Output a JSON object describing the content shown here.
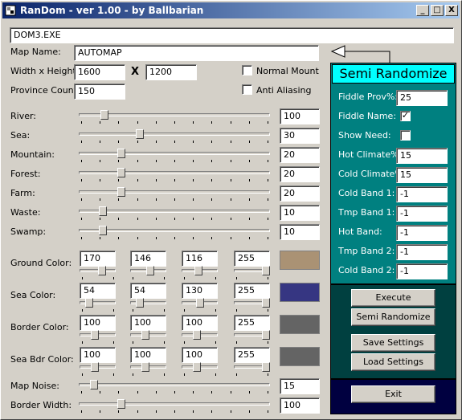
{
  "window": {
    "title": "RanDom - ver 1.00 - by Ballbarian",
    "minimize": "_",
    "maximize": "□",
    "close": "X"
  },
  "exe_field": {
    "value": "DOM3.EXE"
  },
  "map_name": {
    "label": "Map Name:",
    "value": "AUTOMAP"
  },
  "size": {
    "label": "Width x Height:",
    "width": "1600",
    "height": "1200",
    "separator": "X"
  },
  "province": {
    "label": "Province Count:",
    "value": "150"
  },
  "options": {
    "normal_mount": {
      "label": "Normal Mount",
      "checked": false
    },
    "anti_aliasing": {
      "label": "Anti Aliasing",
      "checked": false
    }
  },
  "terrain": [
    {
      "label": "River:",
      "value": "100",
      "level": 0.12
    },
    {
      "label": "Sea:",
      "value": "30",
      "level": 0.31
    },
    {
      "label": "Mountain:",
      "value": "20",
      "level": 0.21
    },
    {
      "label": "Forest:",
      "value": "20",
      "level": 0.21
    },
    {
      "label": "Farm:",
      "value": "20",
      "level": 0.21
    },
    {
      "label": "Waste:",
      "value": "10",
      "level": 0.11
    },
    {
      "label": "Swamp:",
      "value": "10",
      "level": 0.11
    }
  ],
  "colors": [
    {
      "label": "Ground Color:",
      "values": [
        "170",
        "146",
        "116",
        "255"
      ],
      "swatch": "#aa9274"
    },
    {
      "label": "Sea Color:",
      "values": [
        "54",
        "54",
        "130",
        "255"
      ],
      "swatch": "#363682"
    },
    {
      "label": "Border Color:",
      "values": [
        "100",
        "100",
        "100",
        "255"
      ],
      "swatch": "#646464"
    },
    {
      "label": "Sea Bdr Color:",
      "values": [
        "100",
        "100",
        "100",
        "255"
      ],
      "swatch": "#646464"
    }
  ],
  "map_noise": {
    "label": "Map Noise:",
    "value": "15",
    "level": 0.06
  },
  "border_width": {
    "label": "Border Width:",
    "value": "100",
    "level": 0.21
  },
  "semi": {
    "header": "Semi Randomize",
    "fields": [
      {
        "label": "Fiddle Prov%:",
        "value": "25"
      },
      {
        "label": "Fiddle Name:",
        "checkbox": true,
        "checked": true
      },
      {
        "label": "Show Need:",
        "checkbox": true,
        "checked": false
      },
      {
        "label": "Hot Climate%:",
        "value": "15"
      },
      {
        "label": "Cold Climate%:",
        "value": "15"
      },
      {
        "label": "Cold Band 1:",
        "value": "-1"
      },
      {
        "label": "Tmp Band 1:",
        "value": "-1"
      },
      {
        "label": "Hot Band:",
        "value": "-1"
      },
      {
        "label": "Tmp Band 2:",
        "value": "-1"
      },
      {
        "label": "Cold Band 2:",
        "value": "-1"
      }
    ]
  },
  "buttons": {
    "execute": "Execute",
    "semi_randomize": "Semi Randomize",
    "save_settings": "Save Settings",
    "load_settings": "Load Settings",
    "exit": "Exit"
  },
  "palette": {
    "panel_teal": "#008080",
    "panel_dark": "#004040",
    "panel_navy": "#000040",
    "header_cyan": "#00ffff"
  }
}
